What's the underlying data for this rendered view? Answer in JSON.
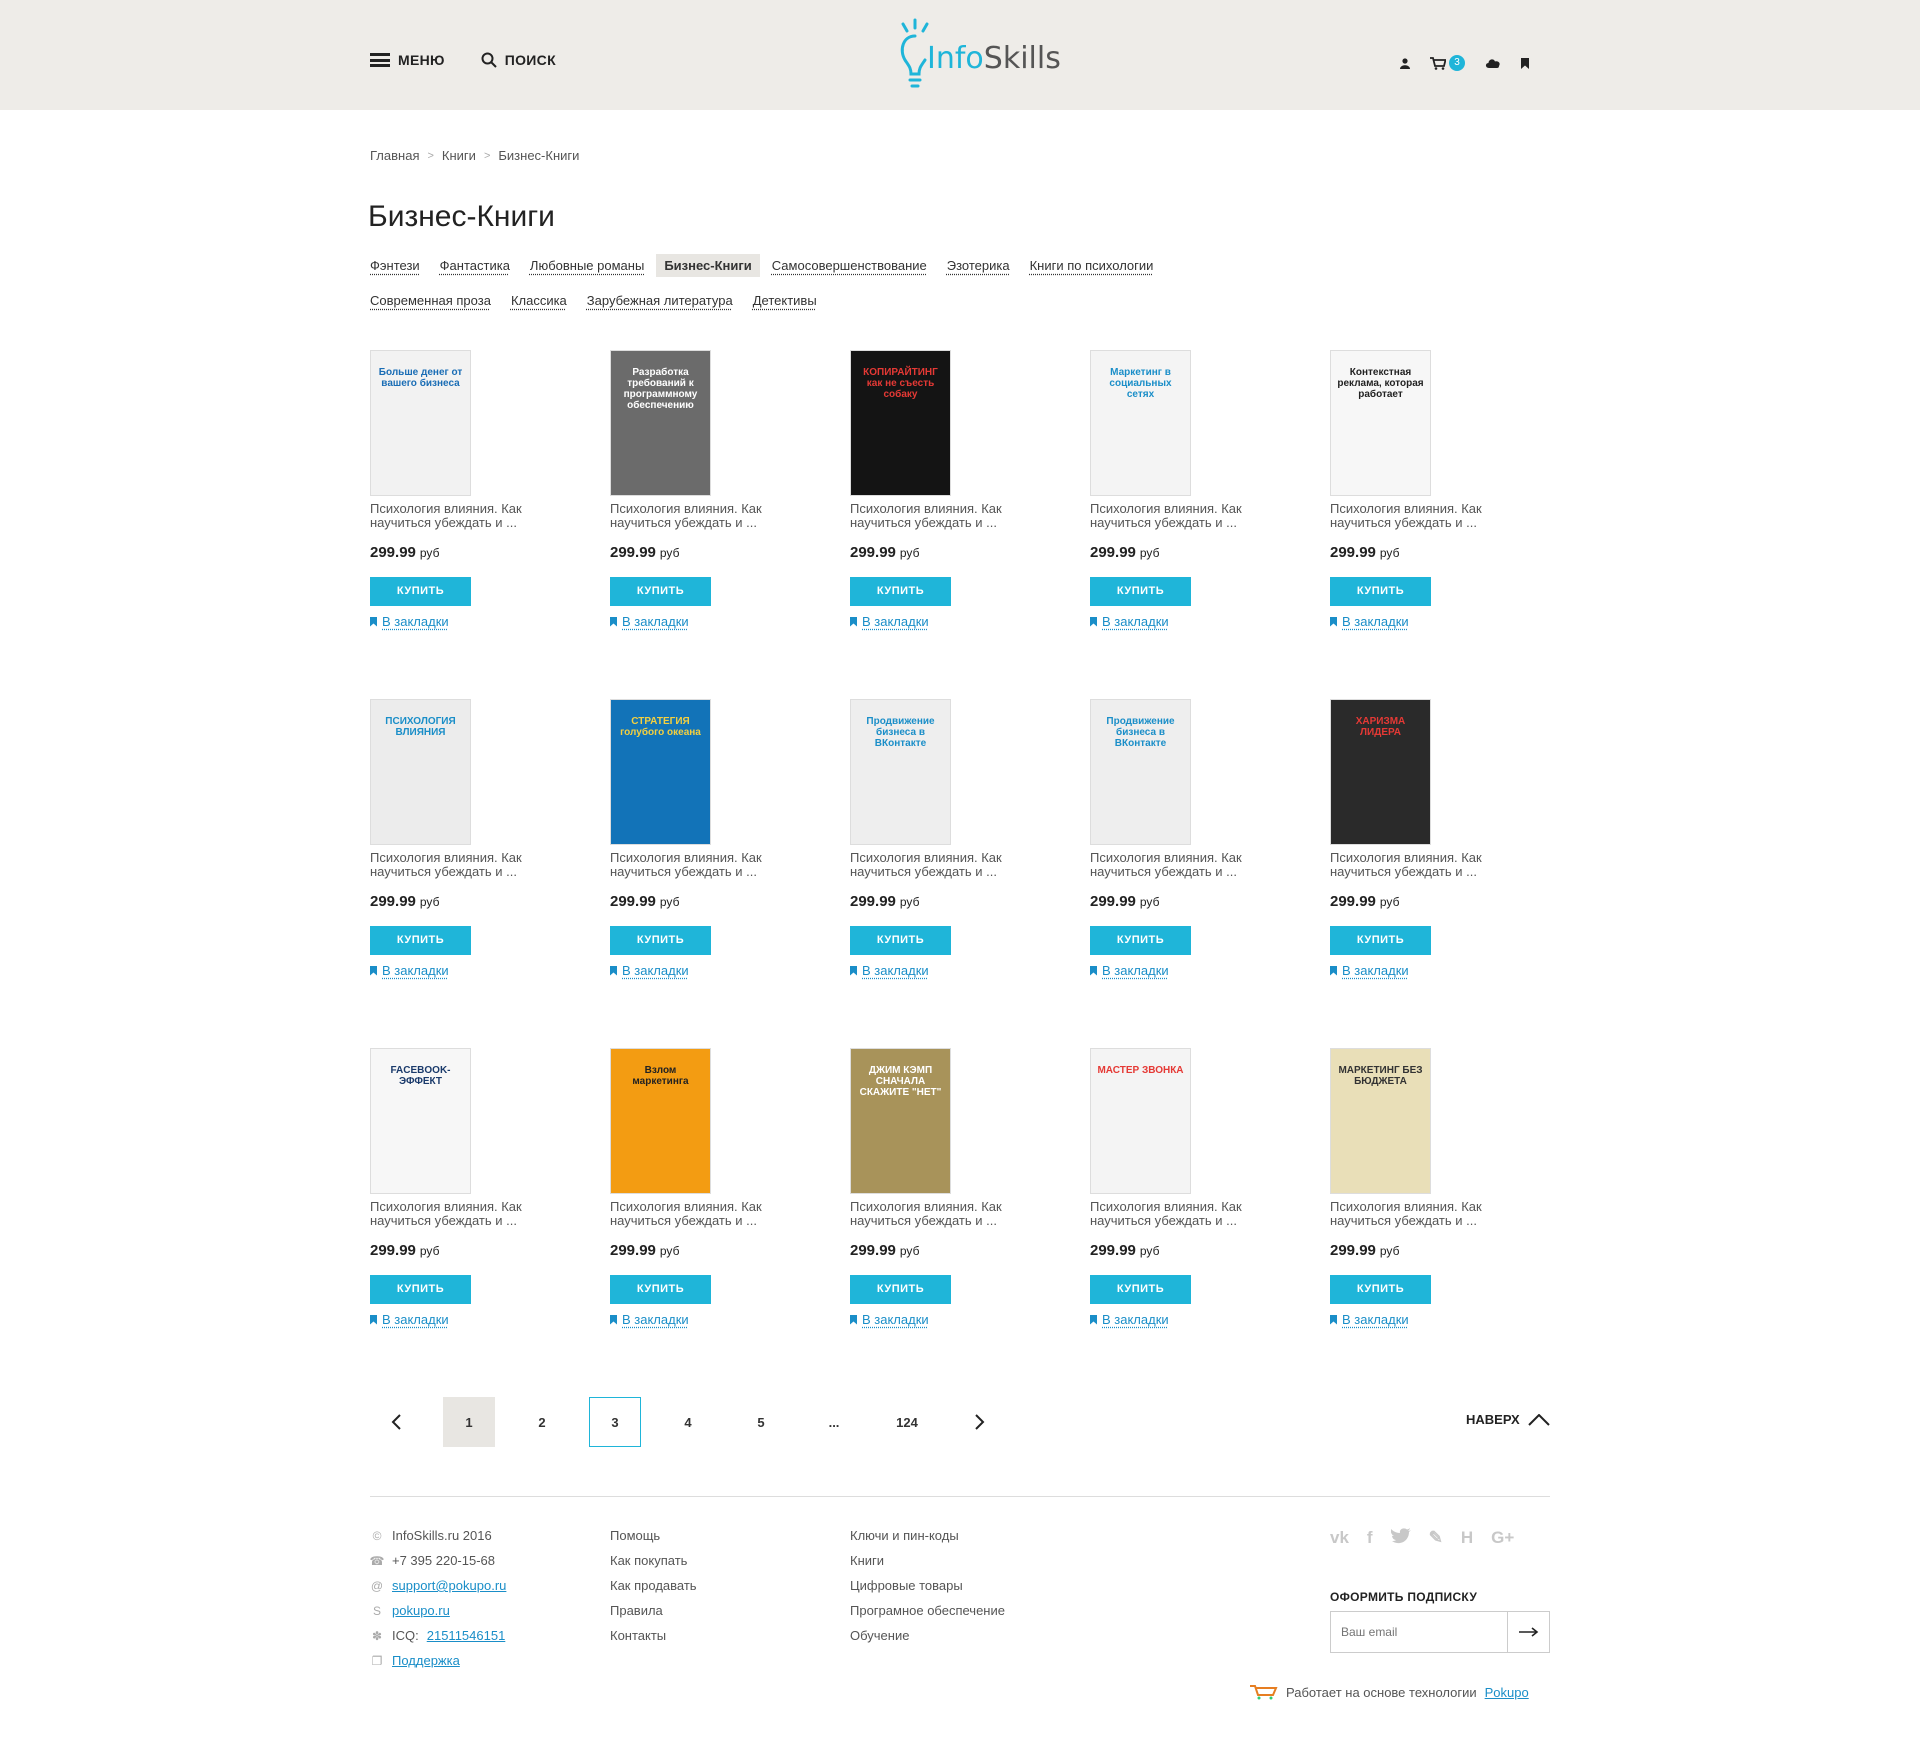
{
  "header": {
    "menu_label": "МЕНЮ",
    "search_label": "ПОИСК",
    "logo_info": "Info",
    "logo_skills": "Skills",
    "cart_count": "3",
    "accent": "#1fb5d9"
  },
  "breadcrumb": [
    "Главная",
    "Книги",
    "Бизнес-Книги"
  ],
  "page_title": "Бизнес-Книги",
  "categories": [
    {
      "label": "Фэнтези",
      "active": false
    },
    {
      "label": "Фантастика",
      "active": false
    },
    {
      "label": "Любовные романы",
      "active": false
    },
    {
      "label": "Бизнес-Книги",
      "active": true
    },
    {
      "label": "Самосовершенствование",
      "active": false
    },
    {
      "label": "Эзотерика",
      "active": false
    },
    {
      "label": "Книги по психологии",
      "active": false
    },
    {
      "label": "Современная проза",
      "active": false
    },
    {
      "label": "Классика",
      "active": false
    },
    {
      "label": "Зарубежная литература",
      "active": false
    },
    {
      "label": "Детективы",
      "active": false
    }
  ],
  "product_common": {
    "title": "Психология влияния. Как научиться убеждать и ...",
    "price": "299.99",
    "currency": "руб",
    "buy_label": "КУПИТЬ",
    "bookmark_label": "В закладки"
  },
  "products": [
    {
      "cover_text": "Больше денег от вашего бизнеса",
      "cover_bg": "#f2f2f2",
      "cover_fg": "#1a6db5"
    },
    {
      "cover_text": "Разработка требований к программному обеспечению",
      "cover_bg": "#6b6b6b",
      "cover_fg": "#ffffff"
    },
    {
      "cover_text": "КОПИРАЙТИНГ как не съесть собаку",
      "cover_bg": "#141414",
      "cover_fg": "#e53935"
    },
    {
      "cover_text": "Маркетинг в социальных сетях",
      "cover_bg": "#f4f4f4",
      "cover_fg": "#1a8ec8"
    },
    {
      "cover_text": "Контекстная реклама, которая работает",
      "cover_bg": "#f7f7f7",
      "cover_fg": "#222222"
    },
    {
      "cover_text": "ПСИХОЛОГИЯ ВЛИЯНИЯ",
      "cover_bg": "#ececec",
      "cover_fg": "#1a8ec8"
    },
    {
      "cover_text": "СТРАТЕГИЯ голубого океана",
      "cover_bg": "#1273b8",
      "cover_fg": "#f4d03f"
    },
    {
      "cover_text": "Продвижение бизнеса в ВКонтакте",
      "cover_bg": "#eeeeee",
      "cover_fg": "#1a8ec8"
    },
    {
      "cover_text": "Продвижение бизнеса в ВКонтакте",
      "cover_bg": "#eeeeee",
      "cover_fg": "#1a8ec8"
    },
    {
      "cover_text": "ХАРИЗМА ЛИДЕРА",
      "cover_bg": "#2a2a2a",
      "cover_fg": "#e53935"
    },
    {
      "cover_text": "FACEBOOK-ЭФФЕКТ",
      "cover_bg": "#f7f7f7",
      "cover_fg": "#1a3a6b"
    },
    {
      "cover_text": "Взлом маркетинга",
      "cover_bg": "#f39c12",
      "cover_fg": "#222222"
    },
    {
      "cover_text": "ДЖИМ КЭМП СНАЧАЛА СКАЖИТЕ \"НЕТ\"",
      "cover_bg": "#a8935a",
      "cover_fg": "#ffffff"
    },
    {
      "cover_text": "МАСТЕР ЗВОНКА",
      "cover_bg": "#f4f4f4",
      "cover_fg": "#e53935"
    },
    {
      "cover_text": "МАРКЕТИНГ БЕЗ БЮДЖЕТА",
      "cover_bg": "#e9dfb8",
      "cover_fg": "#333333"
    }
  ],
  "pagination": {
    "prev_icon": "chevron-left-icon",
    "pages": [
      "1",
      "2",
      "3",
      "4",
      "5",
      "...",
      "124"
    ],
    "current": "1",
    "hovered": "3",
    "next_icon": "chevron-right-icon",
    "to_top_label": "НАВЕРХ"
  },
  "footer": {
    "contacts": {
      "copyright": "InfoSkills.ru 2016",
      "phone": "+7 395 220-15-68",
      "email": "support@pokupo.ru",
      "skype": "pokupo.ru",
      "icq_label": "ICQ:",
      "icq": "21511546151",
      "support": "Поддержка"
    },
    "col2": [
      "Помощь",
      "Как покупать",
      "Как продавать",
      "Правила",
      "Контакты"
    ],
    "col3": [
      "Ключи и пин-коды",
      "Книги",
      "Цифровые товары",
      "Програмное обеспечение",
      "Обучение"
    ],
    "socials": [
      "vk",
      "f",
      "twitter",
      "lj",
      "odnoklassniki",
      "G+"
    ],
    "subscribe_title": "ОФОРМИТЬ ПОДПИСКУ",
    "email_placeholder": "Ваш email",
    "powered_text": "Работает на основе технологии",
    "powered_link": "Pokupo"
  }
}
